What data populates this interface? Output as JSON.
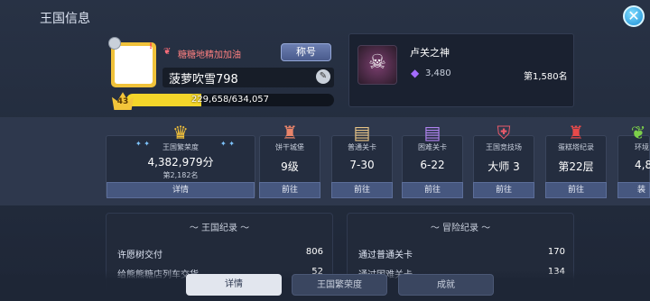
{
  "header": {
    "title": "王国信息"
  },
  "profile": {
    "guild_name": "糖糖地精加加油",
    "title_button": "称号",
    "player_name": "菠萝吹雪798",
    "level": "43",
    "exp_text": "229,658/634,057",
    "exp_fraction": 0.362
  },
  "champion": {
    "title": "卢关之神",
    "score": "3,480",
    "rank": "第1,580名"
  },
  "stats": [
    {
      "label": "王国繁荣度",
      "value": "4,382,979分",
      "sub": "第2,182名",
      "button": "详情",
      "icon": "crown-icon"
    },
    {
      "label": "饼干城堡",
      "value": "9级",
      "button": "前往",
      "icon": "castle-icon"
    },
    {
      "label": "普通关卡",
      "value": "7-30",
      "button": "前往",
      "icon": "map-icon"
    },
    {
      "label": "困难关卡",
      "value": "6-22",
      "button": "前往",
      "icon": "hard-map-icon"
    },
    {
      "label": "王国竞技场",
      "value": "大师 3",
      "button": "前往",
      "icon": "arena-shield-icon"
    },
    {
      "label": "蛋糕塔纪录",
      "value": "第22层",
      "button": "前往",
      "icon": "tower-icon"
    },
    {
      "label": "环境",
      "value": "4,8",
      "button": "装",
      "icon": "leaf-icon"
    }
  ],
  "kingdom_record": {
    "header": "王国纪录",
    "rows": [
      {
        "label": "许愿树交付",
        "value": "806"
      },
      {
        "label": "给熊熊糖店列车交货",
        "value": "52"
      }
    ]
  },
  "adventure_record": {
    "header": "冒险纪录",
    "rows": [
      {
        "label": "通过普通关卡",
        "value": "170"
      },
      {
        "label": "通过困难关卡",
        "value": "134"
      }
    ]
  },
  "tabs": [
    "详情",
    "王国繁荣度",
    "成就"
  ],
  "colors": {
    "accent": "#f4d62a",
    "button": "#46577f",
    "background": "#222b3c"
  }
}
